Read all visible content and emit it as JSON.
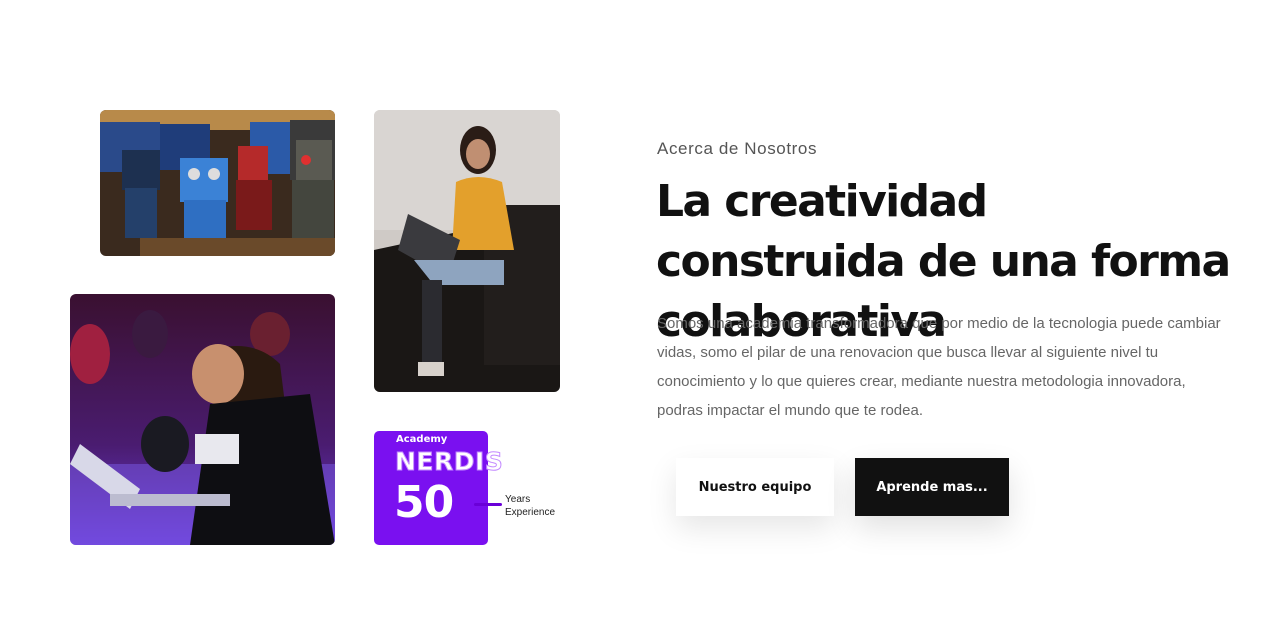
{
  "about": {
    "eyebrow": "Acerca de Nosotros",
    "headline": "La creatividad construida de una forma colaborativa",
    "paragraph": "Somos una academia transformadora que por medio de la tecnologia puede cambiar vidas, somo el pilar de una renovacion que busca llevar al siguiente nivel tu conocimiento y lo que quieres crear, mediante nuestra metodologia innovadora, podras impactar el mundo que te rodea."
  },
  "buttons": {
    "team_label": "Nuestro equipo",
    "learn_label": "Aprende mas..."
  },
  "badge": {
    "academy": "Academy",
    "brand": "NERDIS",
    "number": "50",
    "caption_line1": "Years",
    "caption_line2": "Experience",
    "color": "#7a10f0"
  }
}
